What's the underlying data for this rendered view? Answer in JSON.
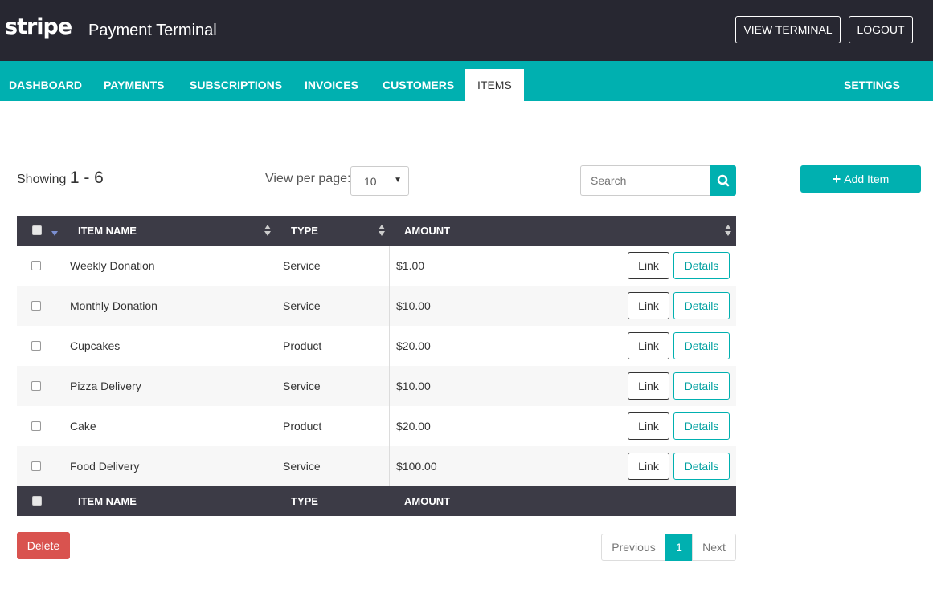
{
  "header": {
    "logo": "stripe",
    "title": "Payment Terminal",
    "view_terminal": "VIEW TERMINAL",
    "logout": "LOGOUT"
  },
  "nav": {
    "items": [
      "DASHBOARD",
      "PAYMENTS",
      "SUBSCRIPTIONS",
      "INVOICES",
      "CUSTOMERS",
      "ITEMS"
    ],
    "active": "ITEMS",
    "settings": "SETTINGS"
  },
  "toolbar": {
    "showing_label": "Showing",
    "showing_range": "1 - 6",
    "view_per_page_label": "View per page:",
    "view_per_page_value": "10",
    "search_placeholder": "Search",
    "search_icon": "magnifier-icon",
    "add_item": "Add Item"
  },
  "table": {
    "columns": [
      "ITEM NAME",
      "TYPE",
      "AMOUNT"
    ],
    "link_label": "Link",
    "details_label": "Details",
    "rows": [
      {
        "name": "Weekly Donation",
        "type": "Service",
        "amount": "$1.00"
      },
      {
        "name": "Monthly Donation",
        "type": "Service",
        "amount": "$10.00"
      },
      {
        "name": "Cupcakes",
        "type": "Product",
        "amount": "$20.00"
      },
      {
        "name": "Pizza Delivery",
        "type": "Service",
        "amount": "$10.00"
      },
      {
        "name": "Cake",
        "type": "Product",
        "amount": "$20.00"
      },
      {
        "name": "Food Delivery",
        "type": "Service",
        "amount": "$100.00"
      }
    ]
  },
  "footer": {
    "delete": "Delete",
    "previous": "Previous",
    "page": "1",
    "next": "Next"
  },
  "colors": {
    "header_bg": "#272731",
    "accent": "#00b0b0",
    "table_header_bg": "#3c3b46",
    "danger": "#d9534f"
  }
}
